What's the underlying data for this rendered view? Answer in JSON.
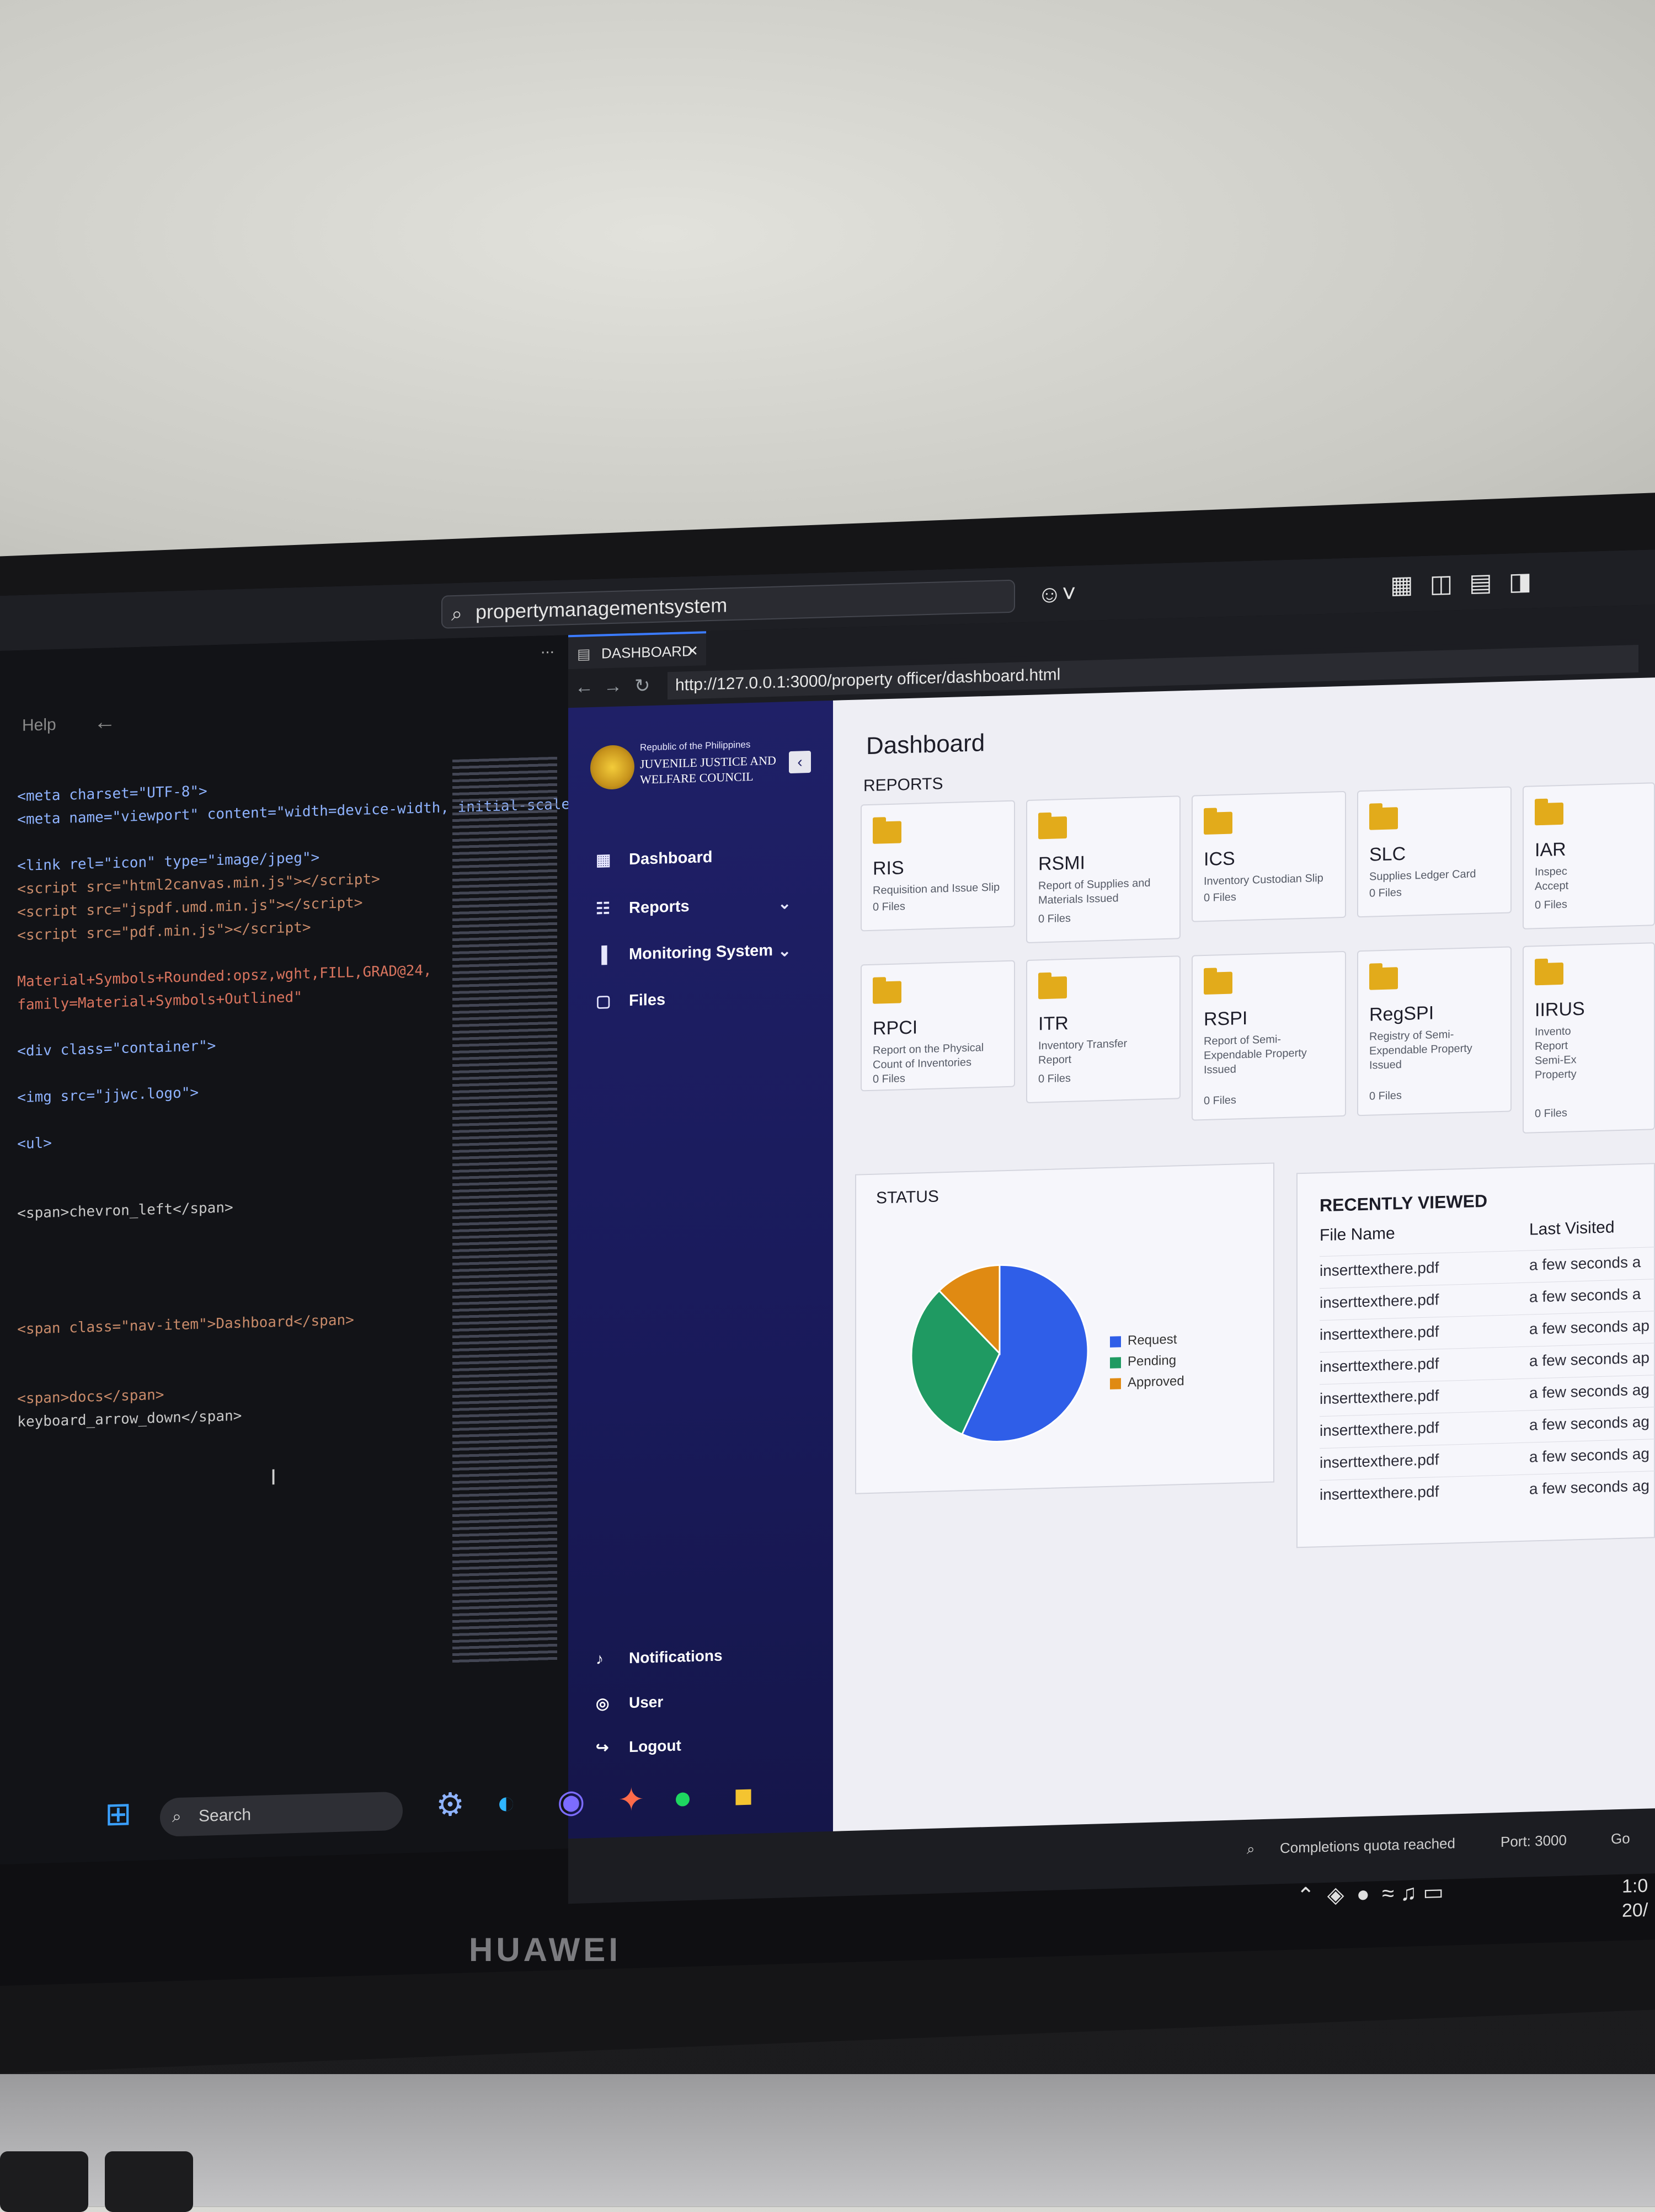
{
  "window": {
    "search": "propertymanagementsystem",
    "menu_help": "Help",
    "more": "..."
  },
  "browser": {
    "tab_label": "DASHBOARD",
    "url": "http://127.0.0.1:3000/property officer/dashboard.html"
  },
  "sidebar": {
    "org_line1": "Republic of the Philippines",
    "org_line2": "JUVENILE JUSTICE AND WELFARE COUNCIL",
    "items": [
      {
        "label": "Dashboard",
        "icon": "dashboard-icon"
      },
      {
        "label": "Reports",
        "icon": "reports-icon"
      },
      {
        "label": "Monitoring System",
        "icon": "chart-icon"
      },
      {
        "label": "Files",
        "icon": "folder-icon"
      }
    ],
    "bottom": [
      {
        "label": "Notifications",
        "icon": "bell-icon"
      },
      {
        "label": "User",
        "icon": "user-icon"
      },
      {
        "label": "Logout",
        "icon": "logout-icon"
      }
    ]
  },
  "main": {
    "title": "Dashboard",
    "reports_heading": "REPORTS",
    "cards": [
      {
        "code": "RIS",
        "desc": "Requisition and Issue Slip",
        "count": "0 Files"
      },
      {
        "code": "RSMI",
        "desc": "Report of Supplies and Materials Issued",
        "count": "0 Files"
      },
      {
        "code": "ICS",
        "desc": "Inventory Custodian Slip",
        "count": "0 Files"
      },
      {
        "code": "SLC",
        "desc": "Supplies Ledger Card",
        "count": "0 Files"
      },
      {
        "code": "IAR",
        "desc": "Inspec Accept",
        "count": "0 Files"
      },
      {
        "code": "RPCI",
        "desc": "Report on the Physical Count of Inventories",
        "count": "0 Files"
      },
      {
        "code": "ITR",
        "desc": "Inventory Transfer Report",
        "count": "0 Files"
      },
      {
        "code": "RSPI",
        "desc": "Report of Semi-Expendable Property Issued",
        "count": "0 Files"
      },
      {
        "code": "RegSPI",
        "desc": "Registry of Semi-Expendable Property Issued",
        "count": "0 Files"
      },
      {
        "code": "IIRUS",
        "desc": "Invento Report Semi-Ex Property",
        "count": "0 Files"
      }
    ],
    "status_heading": "STATUS",
    "recent_heading": "RECENTLY VIEWED",
    "recent_columns": [
      "File Name",
      "Last Visited"
    ],
    "recent_rows": [
      [
        "inserttexthere.pdf",
        "a few seconds a"
      ],
      [
        "inserttexthere.pdf",
        "a few seconds a"
      ],
      [
        "inserttexthere.pdf",
        "a few seconds ap"
      ],
      [
        "inserttexthere.pdf",
        "a few seconds ap"
      ],
      [
        "inserttexthere.pdf",
        "a few seconds ag"
      ],
      [
        "inserttexthere.pdf",
        "a few seconds ag"
      ],
      [
        "inserttexthere.pdf",
        "a few seconds ag"
      ],
      [
        "inserttexthere.pdf",
        "a few seconds ag"
      ]
    ]
  },
  "chart_data": {
    "type": "pie",
    "series": [
      {
        "name": "Request",
        "value": 57,
        "color": "#2f5ee8"
      },
      {
        "name": "Pending",
        "value": 31,
        "color": "#1f9a62"
      },
      {
        "name": "Approved",
        "value": 12,
        "color": "#e08a12"
      }
    ]
  },
  "taskbar": {
    "search": "Search",
    "status_completions": "Completions quota reached",
    "status_port": "Port: 3000",
    "status_go": "Go",
    "clock_time": "1:0",
    "clock_date": "20/"
  },
  "brand": "HUAWEI"
}
